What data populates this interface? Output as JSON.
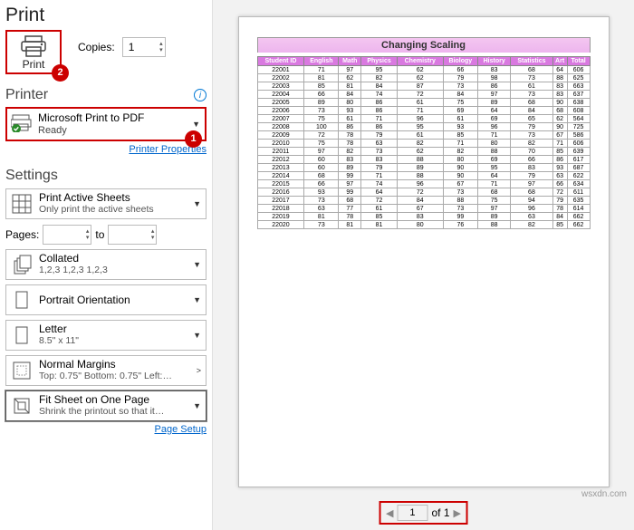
{
  "title": "Print",
  "print_button": {
    "label": "Print"
  },
  "badges": {
    "print": "2",
    "printer": "1"
  },
  "copies": {
    "label": "Copies:",
    "value": "1"
  },
  "printer_section": "Printer",
  "printer": {
    "name": "Microsoft Print to PDF",
    "status": "Ready",
    "props": "Printer Properties"
  },
  "settings_section": "Settings",
  "settings": {
    "sheets": {
      "main": "Print Active Sheets",
      "sub": "Only print the active sheets"
    },
    "pages": {
      "label": "Pages:",
      "to": "to"
    },
    "collated": {
      "main": "Collated",
      "sub": "1,2,3    1,2,3    1,2,3"
    },
    "orient": {
      "main": "Portrait Orientation"
    },
    "paper": {
      "main": "Letter",
      "sub": "8.5\" x 11\""
    },
    "margins": {
      "main": "Normal Margins",
      "sub": "Top: 0.75\" Bottom: 0.75\" Left:…"
    },
    "fit": {
      "main": "Fit Sheet on One Page",
      "sub": "Shrink the printout so that it…"
    },
    "setup": "Page Setup"
  },
  "nav": {
    "current": "1",
    "of": "of 1"
  },
  "watermark": "wsxdn.com",
  "chart_data": {
    "type": "table",
    "title": "Changing Scaling",
    "columns": [
      "Student ID",
      "English",
      "Math",
      "Physics",
      "Chemistry",
      "Biology",
      "History",
      "Statistics",
      "Art",
      "Total"
    ],
    "rows": [
      [
        "22001",
        "71",
        "97",
        "95",
        "62",
        "66",
        "83",
        "68",
        "64",
        "606"
      ],
      [
        "22002",
        "81",
        "62",
        "82",
        "62",
        "79",
        "98",
        "73",
        "88",
        "625"
      ],
      [
        "22003",
        "85",
        "81",
        "84",
        "87",
        "73",
        "86",
        "61",
        "83",
        "663"
      ],
      [
        "22004",
        "66",
        "84",
        "74",
        "72",
        "84",
        "97",
        "73",
        "83",
        "637"
      ],
      [
        "22005",
        "89",
        "80",
        "86",
        "61",
        "75",
        "89",
        "68",
        "90",
        "638"
      ],
      [
        "22006",
        "73",
        "93",
        "86",
        "71",
        "69",
        "64",
        "84",
        "68",
        "608"
      ],
      [
        "22007",
        "75",
        "61",
        "71",
        "96",
        "61",
        "69",
        "65",
        "62",
        "564"
      ],
      [
        "22008",
        "100",
        "86",
        "86",
        "95",
        "93",
        "96",
        "79",
        "90",
        "725"
      ],
      [
        "22009",
        "72",
        "78",
        "79",
        "61",
        "85",
        "71",
        "73",
        "67",
        "586"
      ],
      [
        "22010",
        "75",
        "78",
        "63",
        "82",
        "71",
        "80",
        "82",
        "71",
        "606"
      ],
      [
        "22011",
        "97",
        "82",
        "73",
        "62",
        "82",
        "88",
        "70",
        "85",
        "639"
      ],
      [
        "22012",
        "60",
        "83",
        "83",
        "88",
        "80",
        "69",
        "66",
        "86",
        "617"
      ],
      [
        "22013",
        "60",
        "89",
        "79",
        "89",
        "90",
        "95",
        "83",
        "93",
        "687"
      ],
      [
        "22014",
        "68",
        "99",
        "71",
        "88",
        "90",
        "64",
        "79",
        "63",
        "622"
      ],
      [
        "22015",
        "66",
        "97",
        "74",
        "96",
        "67",
        "71",
        "97",
        "66",
        "634"
      ],
      [
        "22016",
        "93",
        "99",
        "64",
        "72",
        "73",
        "68",
        "68",
        "72",
        "611"
      ],
      [
        "22017",
        "73",
        "68",
        "72",
        "84",
        "88",
        "75",
        "94",
        "79",
        "635"
      ],
      [
        "22018",
        "63",
        "77",
        "61",
        "67",
        "73",
        "97",
        "96",
        "78",
        "614"
      ],
      [
        "22019",
        "81",
        "78",
        "85",
        "83",
        "99",
        "89",
        "63",
        "84",
        "662"
      ],
      [
        "22020",
        "73",
        "81",
        "81",
        "80",
        "76",
        "88",
        "82",
        "85",
        "662"
      ]
    ]
  }
}
